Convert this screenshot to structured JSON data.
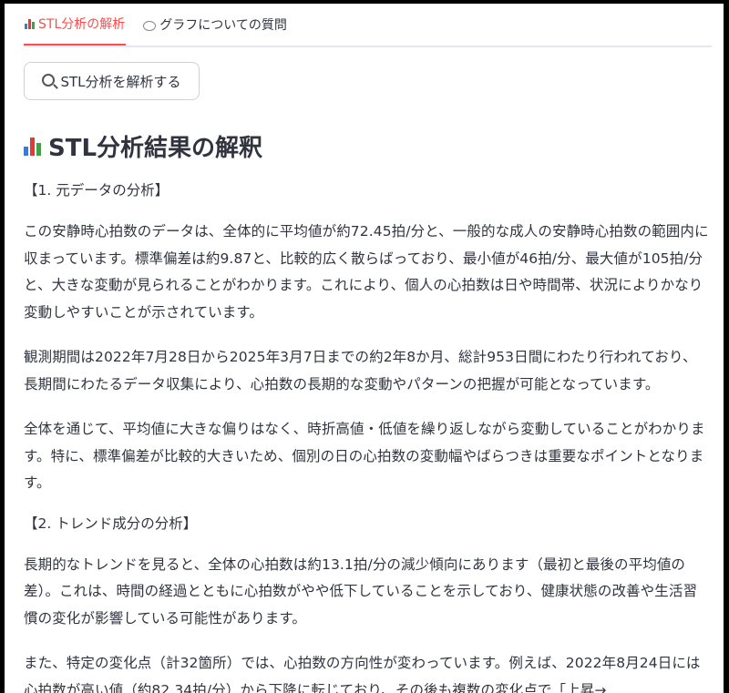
{
  "tabs": [
    {
      "label": "STL分析の解析",
      "icon": "bar-chart-icon",
      "active": true
    },
    {
      "label": "グラフについての質問",
      "icon": "speech-bubble-icon",
      "active": false
    }
  ],
  "analyze_button": {
    "label": "STL分析を解析する",
    "icon": "magnifier-icon"
  },
  "main": {
    "title": "STL分析結果の解釈",
    "sections": [
      {
        "heading": "【1. 元データの分析】",
        "paragraphs": [
          "この安静時心拍数のデータは、全体的に平均値が約72.45拍/分と、一般的な成人の安静時心拍数の範囲内に収まっています。標準偏差は約9.87と、比較的広く散らばっており、最小値が46拍/分、最大値が105拍/分と、大きな変動が見られることがわかります。これにより、個人の心拍数は日や時間帯、状況によりかなり変動しやすいことが示されています。",
          "観測期間は2022年7月28日から2025年3月7日までの約2年8か月、総計953日間にわたり行われており、長期間にわたるデータ収集により、心拍数の長期的な変動やパターンの把握が可能となっています。",
          "全体を通じて、平均値に大きな偏りはなく、時折高値・低値を繰り返しながら変動していることがわかります。特に、標準偏差が比較的大きいため、個別の日の心拍数の変動幅やばらつきは重要なポイントとなります。"
        ]
      },
      {
        "heading": "【2. トレンド成分の分析】",
        "paragraphs": [
          "長期的なトレンドを見ると、全体の心拍数は約13.1拍/分の減少傾向にあります（最初と最後の平均値の差）。これは、時間の経過とともに心拍数がやや低下していることを示しており、健康状態の改善や生活習慣の変化が影響している可能性があります。",
          "また、特定の変化点（計32箇所）では、心拍数の方向性が変わっています。例えば、2022年8月24日には心拍数が高い値（約82.34拍/分）から下降に転じており、その後も複数の変化点で「上昇→"
        ]
      }
    ]
  },
  "colors": {
    "accent": "#ff4b4b",
    "text": "#31333f",
    "border": "#e6e8ee"
  }
}
